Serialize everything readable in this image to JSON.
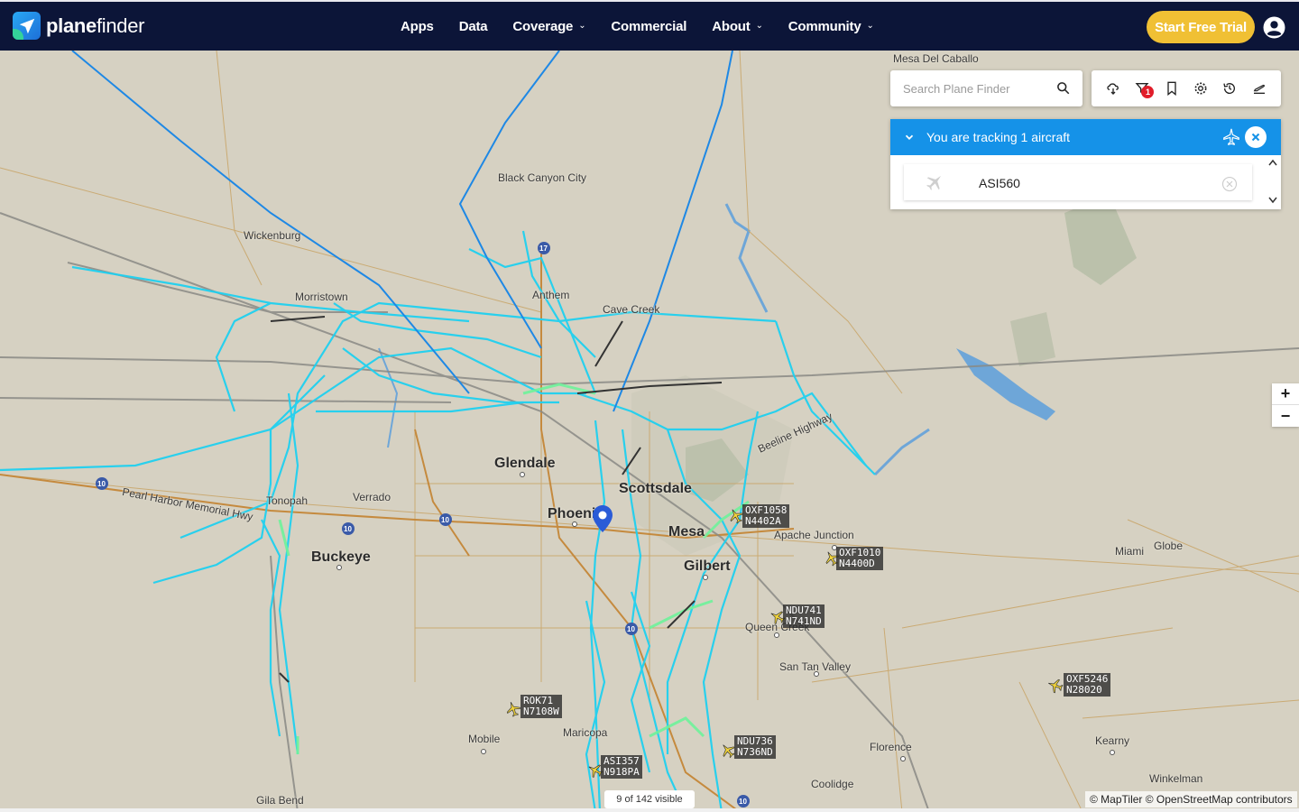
{
  "brand": {
    "name_bold": "plane",
    "name_rest": "finder",
    "icon": "planefinder-logo-icon",
    "accent": "#1d6fd8"
  },
  "nav": {
    "items": [
      {
        "label": "Apps",
        "dropdown": false
      },
      {
        "label": "Data",
        "dropdown": false
      },
      {
        "label": "Coverage",
        "dropdown": true
      },
      {
        "label": "Commercial",
        "dropdown": false
      },
      {
        "label": "About",
        "dropdown": true
      },
      {
        "label": "Community",
        "dropdown": true
      }
    ],
    "cta_label": "Start Free Trial",
    "cta_color": "#f0c034",
    "user_icon": "user-account-icon"
  },
  "search": {
    "placeholder": "Search Plane Finder",
    "icon": "search-icon"
  },
  "toolbar": {
    "tools": [
      "weather-icon",
      "filter-icon",
      "bookmark-icon",
      "settings-icon",
      "history-icon",
      "airport-icon"
    ],
    "filter_badge": "1"
  },
  "tracking": {
    "title": "You are tracking 1 aircraft",
    "aircraft": [
      {
        "callsign": "ASI560"
      }
    ],
    "header_color": "#1592e8"
  },
  "map": {
    "places": [
      {
        "name": "Mesa Del Caballo"
      },
      {
        "name": "Black Canyon City"
      },
      {
        "name": "Wickenburg"
      },
      {
        "name": "Morristown"
      },
      {
        "name": "Anthem"
      },
      {
        "name": "Glendale"
      },
      {
        "name": "Verrado"
      },
      {
        "name": "Phoenix"
      },
      {
        "name": "Scottsdale"
      },
      {
        "name": "Mesa"
      },
      {
        "name": "Apache Junction"
      },
      {
        "name": "Buckeye"
      },
      {
        "name": "Gilbert"
      },
      {
        "name": "Queen Creek"
      },
      {
        "name": "San Tan Valley"
      },
      {
        "name": "Mobile"
      },
      {
        "name": "Maricopa"
      },
      {
        "name": "Florence"
      },
      {
        "name": "Coolidge"
      },
      {
        "name": "Gila Bend"
      },
      {
        "name": "Miami"
      },
      {
        "name": "Globe"
      },
      {
        "name": "Kearny"
      },
      {
        "name": "Winkelman"
      },
      {
        "name": "Tonopah"
      },
      {
        "name": "Pearl Harbor Memorial Hwy"
      },
      {
        "name": "Beeline Highway"
      },
      {
        "name": "Cave Creek"
      }
    ],
    "aircraft_tags": [
      {
        "callsign": "OXF1058",
        "reg": "N4402A"
      },
      {
        "callsign": "OXF1010",
        "reg": "N4400D"
      },
      {
        "callsign": "NDU741",
        "reg": "N741ND"
      },
      {
        "callsign": "OXF5246",
        "reg": "N28020"
      },
      {
        "callsign": "ROK71",
        "reg": "N7108W"
      },
      {
        "callsign": "NDU736",
        "reg": "N736ND"
      },
      {
        "callsign": "ASI357",
        "reg": "N918PA"
      }
    ],
    "track_colors": {
      "primary": "#1fd0f0",
      "secondary": "#6ef29a",
      "dark": "#1e88e5"
    },
    "visible_count": "9 of 142 visible",
    "attribution": "© MapTiler © OpenStreetMap contributors",
    "zoom_in": "+",
    "zoom_out": "−",
    "marker_color": "#2a5bd7"
  }
}
